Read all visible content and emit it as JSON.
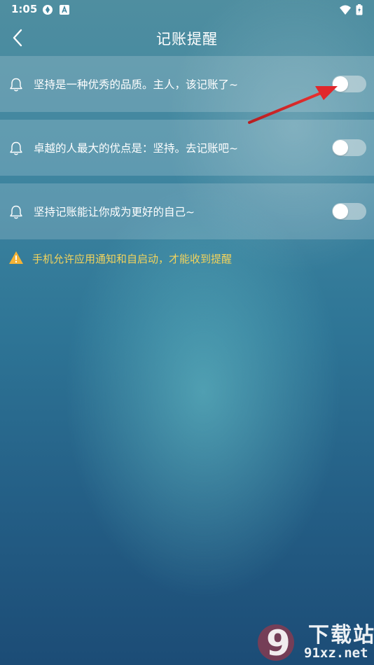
{
  "status_bar": {
    "time": "1:05",
    "left_icons": [
      "sync-icon",
      "notification-a-icon"
    ],
    "right_icons": [
      "wifi-icon",
      "battery-charging-icon"
    ]
  },
  "nav": {
    "back_icon": "chevron-left-icon",
    "title": "记账提醒"
  },
  "reminders": [
    {
      "icon": "bell-icon",
      "label": "坚持是一种优秀的品质。主人，该记账了~",
      "enabled": false
    },
    {
      "icon": "bell-icon",
      "label": "卓越的人最大的优点是：坚持。去记账吧~",
      "enabled": false
    },
    {
      "icon": "bell-icon",
      "label": "坚持记账能让你成为更好的自己~",
      "enabled": false
    }
  ],
  "notice": {
    "icon": "warning-icon",
    "text": "手机允许应用通知和自启动，才能收到提醒",
    "color": "#f2d35c"
  },
  "annotation": {
    "icon": "red-arrow-icon",
    "color": "#e0272b"
  },
  "watermark": {
    "title": "下载站",
    "url": "91xz.net",
    "logo_text": "9"
  },
  "colors": {
    "row_bg": "rgba(255,255,255,0.17)",
    "toggle_off": "#dce6e8"
  }
}
